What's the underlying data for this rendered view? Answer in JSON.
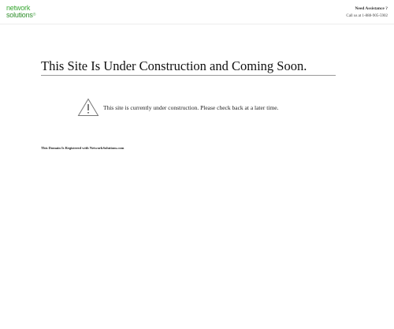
{
  "header": {
    "logo": {
      "line1": "network",
      "line2": "solutions",
      "mark": "®"
    },
    "assistance": {
      "title": "Need Assistance ?",
      "phone": "Call us at 1-888-905-5902"
    }
  },
  "main": {
    "headline": "This Site Is Under Construction and Coming Soon.",
    "notice": "This site is currently under construction. Please check back at a later time.",
    "notice_icon": "warning-triangle-icon",
    "registered": "This Domain Is Registered with NetworkSolutions.com"
  },
  "colors": {
    "brand_green": "#3aa935",
    "headline_rule": "#9a9a9a"
  }
}
